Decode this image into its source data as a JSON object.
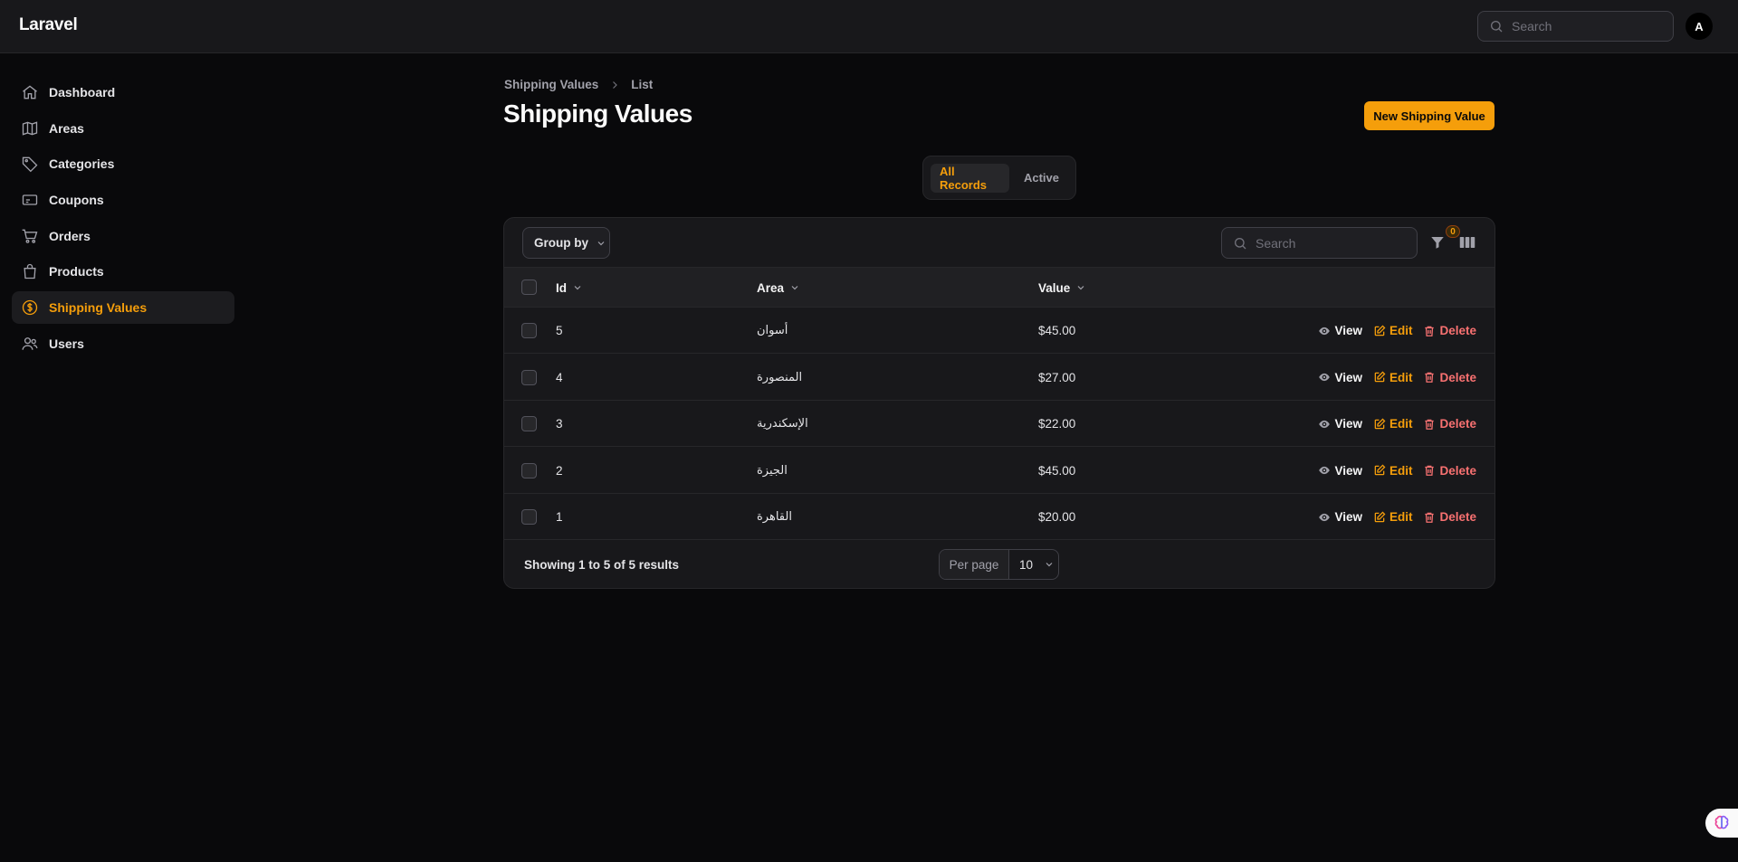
{
  "app": {
    "brand": "Laravel"
  },
  "topbar": {
    "search_placeholder": "Search",
    "avatar_initial": "A"
  },
  "sidebar": {
    "items": [
      {
        "label": "Dashboard",
        "icon": "home-icon"
      },
      {
        "label": "Areas",
        "icon": "map-icon"
      },
      {
        "label": "Categories",
        "icon": "tag-icon"
      },
      {
        "label": "Coupons",
        "icon": "ticket-icon"
      },
      {
        "label": "Orders",
        "icon": "cart-icon"
      },
      {
        "label": "Products",
        "icon": "bag-icon"
      },
      {
        "label": "Shipping Values",
        "icon": "dollar-circle-icon",
        "active": true
      },
      {
        "label": "Users",
        "icon": "users-icon"
      }
    ]
  },
  "breadcrumb": {
    "parent": "Shipping Values",
    "current": "List"
  },
  "page": {
    "title": "Shipping Values",
    "new_button": "New Shipping Value"
  },
  "tabs": [
    {
      "label": "All Records",
      "active": true
    },
    {
      "label": "Active",
      "active": false
    }
  ],
  "table": {
    "group_by_label": "Group by",
    "search_placeholder": "Search",
    "filter_count": "0",
    "columns": {
      "id": "Id",
      "area": "Area",
      "value": "Value"
    },
    "actions": {
      "view": "View",
      "edit": "Edit",
      "delete": "Delete"
    },
    "rows": [
      {
        "id": "5",
        "area": "أسوان",
        "value": "$45.00"
      },
      {
        "id": "4",
        "area": "المنصورة",
        "value": "$27.00"
      },
      {
        "id": "3",
        "area": "الإسكندرية",
        "value": "$22.00"
      },
      {
        "id": "2",
        "area": "الجيزة",
        "value": "$45.00"
      },
      {
        "id": "1",
        "area": "القاهرة",
        "value": "$20.00"
      }
    ],
    "footer": {
      "showing": "Showing 1 to 5 of 5 results",
      "per_page_label": "Per page",
      "per_page_value": "10"
    }
  },
  "colors": {
    "accent": "#f59e0b",
    "danger": "#f87171",
    "background": "#09090b",
    "surface": "#18181b"
  }
}
